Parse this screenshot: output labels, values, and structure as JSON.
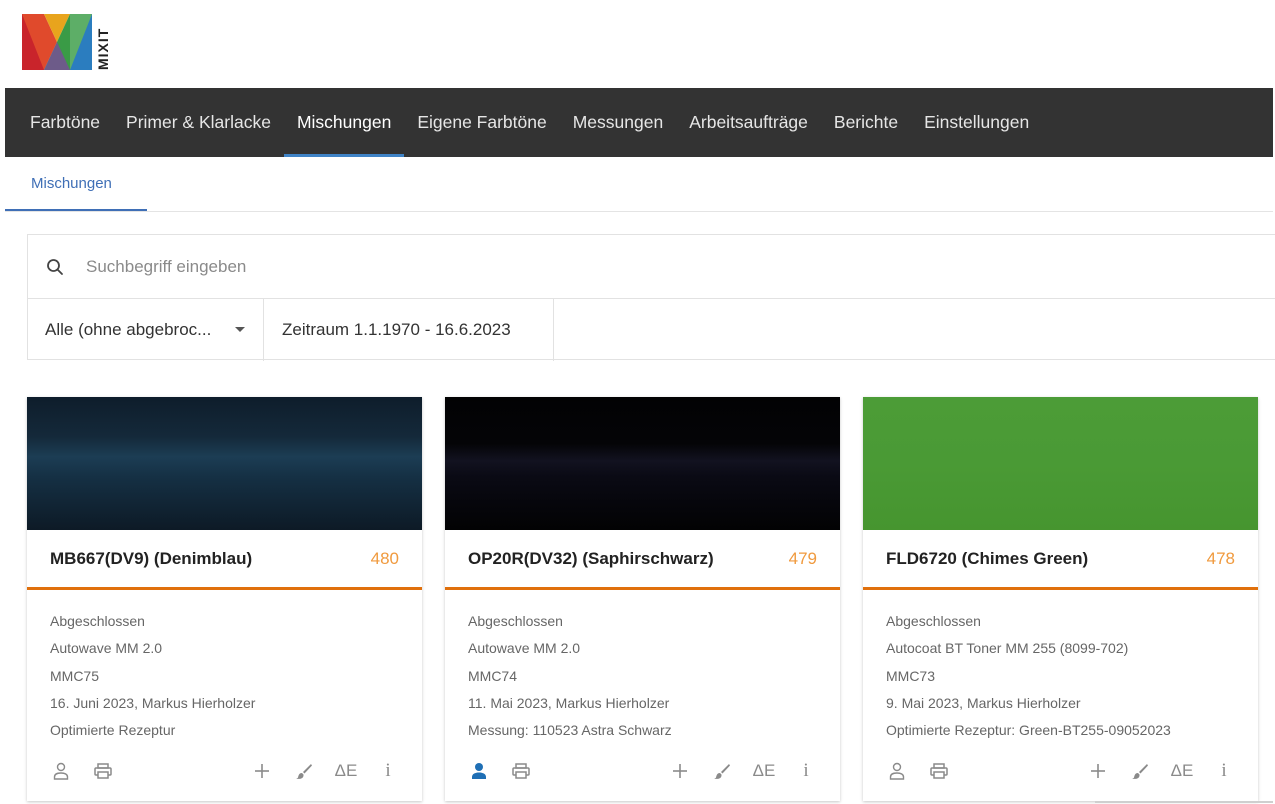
{
  "logo": {
    "text": "MIXIT"
  },
  "nav": {
    "items": [
      {
        "label": "Farbtöne",
        "active": false
      },
      {
        "label": "Primer & Klarlacke",
        "active": false
      },
      {
        "label": "Mischungen",
        "active": true
      },
      {
        "label": "Eigene Farbtöne",
        "active": false
      },
      {
        "label": "Messungen",
        "active": false
      },
      {
        "label": "Arbeitsaufträge",
        "active": false
      },
      {
        "label": "Berichte",
        "active": false
      },
      {
        "label": "Einstellungen",
        "active": false
      }
    ]
  },
  "subtabs": {
    "active_label": "Mischungen"
  },
  "search": {
    "placeholder": "Suchbegriff eingeben",
    "value": ""
  },
  "filters": {
    "status_selected": "Alle (ohne abgebroc...",
    "range_label": "Zeitraum 1.1.1970 - 16.6.2023"
  },
  "colors": {
    "accent_orange": "#e0700c",
    "count_orange": "#f09a3e",
    "nav_bg": "#333333",
    "link_blue": "#3f6fb6",
    "user_active_blue": "#1f6fb5"
  },
  "cards": [
    {
      "title": "MB667(DV9) (Denimblau)",
      "count": "480",
      "swatch_color": "#13283a",
      "lines": [
        "Abgeschlossen",
        "Autowave MM 2.0",
        "MMC75",
        "16. Juni 2023,  Markus  Hierholzer",
        "Optimierte Rezeptur"
      ],
      "user_icon_active": false,
      "delta_e_label": "ΔE",
      "info_label": "i"
    },
    {
      "title": "OP20R(DV32) (Saphirschwarz)",
      "count": "479",
      "swatch_color": "#040406",
      "lines": [
        "Abgeschlossen",
        "Autowave MM 2.0",
        "MMC74",
        "11. Mai 2023,  Markus  Hierholzer",
        "Messung: 110523 Astra Schwarz"
      ],
      "user_icon_active": true,
      "delta_e_label": "ΔE",
      "info_label": "i"
    },
    {
      "title": "FLD6720 (Chimes Green)",
      "count": "478",
      "swatch_color": "#4a9a35",
      "lines": [
        "Abgeschlossen",
        "Autocoat BT Toner MM 255 (8099-702)",
        "MMC73",
        "9. Mai 2023,  Markus  Hierholzer",
        "Optimierte Rezeptur: Green-BT255-09052023"
      ],
      "user_icon_active": false,
      "delta_e_label": "ΔE",
      "info_label": "i"
    }
  ]
}
